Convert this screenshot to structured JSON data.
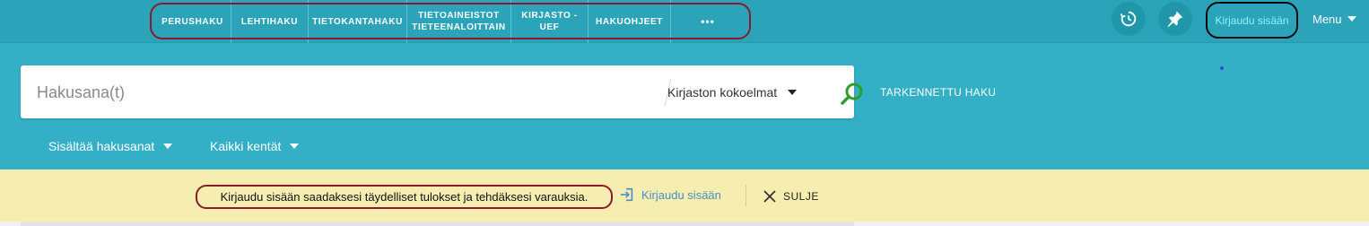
{
  "nav": {
    "items": [
      {
        "lines": [
          "PERUSHAKU"
        ]
      },
      {
        "lines": [
          "LEHTIHAKU"
        ]
      },
      {
        "lines": [
          "TIETOKANTAHAKU"
        ]
      },
      {
        "lines": [
          "TIETOAINEISTOT",
          "TIETEENALOITTAIN"
        ]
      },
      {
        "lines": [
          "KIRJASTO -",
          "UEF"
        ]
      },
      {
        "lines": [
          "HAKUOHJEET"
        ]
      },
      {
        "lines": [
          "•••"
        ]
      }
    ]
  },
  "header": {
    "history_icon": "history-icon",
    "pin_icon": "pin-icon",
    "login_label": "Kirjaudu sisään",
    "menu_label": "Menu"
  },
  "search": {
    "placeholder": "Hakusana(t)",
    "scope_label": "Kirjaston kokoelmat",
    "submit_icon": "search-icon",
    "advanced_label": "TARKENNETTU HAKU"
  },
  "filters": {
    "match_label": "Sisältää hakusanat",
    "fields_label": "Kaikki kentät"
  },
  "banner": {
    "message": "Kirjaudu sisään saadaksesi täydelliset tulokset ja tehdäksesi varauksia.",
    "login_label": "Kirjaudu sisään",
    "close_label": "SULJE"
  },
  "colors": {
    "background": "#34b0c6",
    "topbar": "#2ba4ba",
    "banner": "#f6eeb1",
    "login_link": "#8cf2ff",
    "search_icon": "#2f9e2f",
    "annotation_oval": "#8b1a2a"
  }
}
